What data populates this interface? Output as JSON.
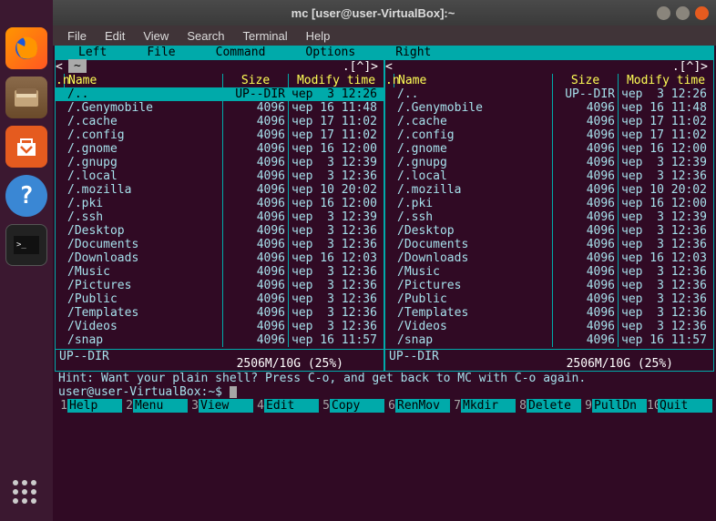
{
  "window_title": "mc [user@user-VirtualBox]:~",
  "menubar": [
    "File",
    "Edit",
    "View",
    "Search",
    "Terminal",
    "Help"
  ],
  "mc_menu": [
    "Left",
    "File",
    "Command",
    "Options",
    "Right"
  ],
  "columns": {
    "n": ".n",
    "name": "Name",
    "size": "Size",
    "mtime": "Modify time"
  },
  "tab_label": "~",
  "arrows": ".[^]>",
  "files": [
    {
      "name": "/..",
      "size": "UP--DIR",
      "mtime": "чер  3 12:26",
      "sel": true
    },
    {
      "name": "/.Genymobile",
      "size": "4096",
      "mtime": "чер 16 11:48"
    },
    {
      "name": "/.cache",
      "size": "4096",
      "mtime": "чер 17 11:02"
    },
    {
      "name": "/.config",
      "size": "4096",
      "mtime": "чер 17 11:02"
    },
    {
      "name": "/.gnome",
      "size": "4096",
      "mtime": "чер 16 12:00"
    },
    {
      "name": "/.gnupg",
      "size": "4096",
      "mtime": "чер  3 12:39"
    },
    {
      "name": "/.local",
      "size": "4096",
      "mtime": "чер  3 12:36"
    },
    {
      "name": "/.mozilla",
      "size": "4096",
      "mtime": "чер 10 20:02"
    },
    {
      "name": "/.pki",
      "size": "4096",
      "mtime": "чер 16 12:00"
    },
    {
      "name": "/.ssh",
      "size": "4096",
      "mtime": "чер  3 12:39"
    },
    {
      "name": "/Desktop",
      "size": "4096",
      "mtime": "чер  3 12:36"
    },
    {
      "name": "/Documents",
      "size": "4096",
      "mtime": "чер  3 12:36"
    },
    {
      "name": "/Downloads",
      "size": "4096",
      "mtime": "чер 16 12:03"
    },
    {
      "name": "/Music",
      "size": "4096",
      "mtime": "чер  3 12:36"
    },
    {
      "name": "/Pictures",
      "size": "4096",
      "mtime": "чер  3 12:36"
    },
    {
      "name": "/Public",
      "size": "4096",
      "mtime": "чер  3 12:36"
    },
    {
      "name": "/Templates",
      "size": "4096",
      "mtime": "чер  3 12:36"
    },
    {
      "name": "/Videos",
      "size": "4096",
      "mtime": "чер  3 12:36"
    },
    {
      "name": "/snap",
      "size": "4096",
      "mtime": "чер 16 11:57"
    }
  ],
  "panel_status": "UP--DIR",
  "disk": "2506M/10G (25%)",
  "hint": "Hint: Want your plain shell? Press C-o, and get back to MC with C-o again.",
  "prompt": "user@user-VirtualBox:~$ ",
  "fkeys": [
    {
      "n": "1",
      "l": "Help"
    },
    {
      "n": "2",
      "l": "Menu"
    },
    {
      "n": "3",
      "l": "View"
    },
    {
      "n": "4",
      "l": "Edit"
    },
    {
      "n": "5",
      "l": "Copy"
    },
    {
      "n": "6",
      "l": "RenMov"
    },
    {
      "n": "7",
      "l": "Mkdir"
    },
    {
      "n": "8",
      "l": "Delete"
    },
    {
      "n": "9",
      "l": "PullDn"
    },
    {
      "n": "10",
      "l": "Quit"
    }
  ]
}
